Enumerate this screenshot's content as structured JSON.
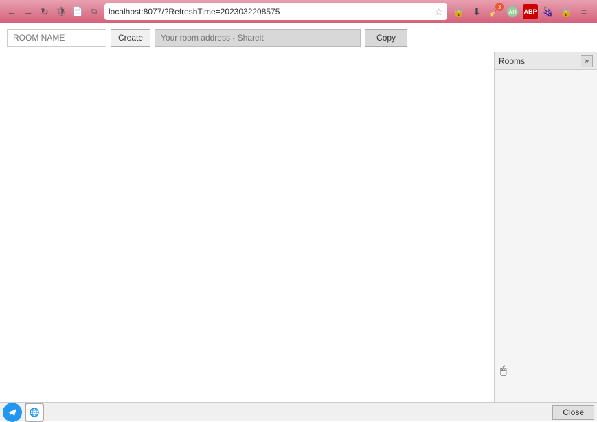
{
  "browser": {
    "address": "localhost:8077/?RefreshTime=2023032208575",
    "back_label": "←",
    "forward_label": "→",
    "refresh_label": "↻",
    "shield_icon": "🛡",
    "page_icon": "📄",
    "pip_icon": "⧉",
    "star_icon": "☆",
    "pocket_icon": "⬇",
    "download_icon": "⬇",
    "extension_badge": "3",
    "menu_icon": "≡"
  },
  "toolbar": {
    "room_name_placeholder": "ROOM NAME",
    "create_label": "Create",
    "room_address_placeholder": "Your room address - Shareit",
    "copy_label": "Copy"
  },
  "rooms_panel": {
    "title": "Rooms",
    "collapse_icon": "»"
  },
  "status_bar": {
    "close_label": "Close"
  }
}
